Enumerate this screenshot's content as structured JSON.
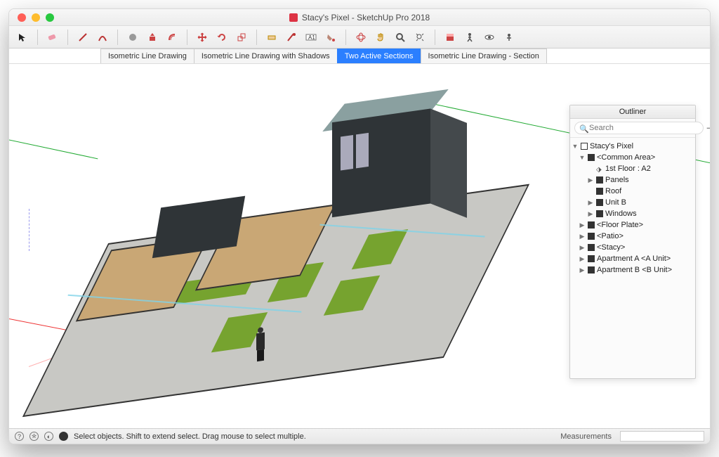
{
  "window": {
    "title": "Stacy's Pixel - SketchUp Pro 2018"
  },
  "toolbar_icons": [
    "select",
    "eraser",
    "line",
    "arc",
    "shape",
    "pushpull",
    "offset",
    "move",
    "rotate",
    "scale",
    "tape",
    "protractor",
    "text",
    "dimension",
    "paint",
    "orbit",
    "pan",
    "zoom",
    "section",
    "walk",
    "position",
    "lookAround"
  ],
  "scenes": [
    {
      "label": "Isometric Line Drawing",
      "active": false
    },
    {
      "label": "Isometric Line Drawing with Shadows",
      "active": false
    },
    {
      "label": "Two Active Sections",
      "active": true
    },
    {
      "label": "Isometric Line Drawing - Section",
      "active": false
    }
  ],
  "outliner": {
    "title": "Outliner",
    "search_placeholder": "Search",
    "items": [
      {
        "depth": 0,
        "tw": "▼",
        "icon": "mdl",
        "label": "Stacy's Pixel"
      },
      {
        "depth": 1,
        "tw": "▼",
        "icon": "grp",
        "label": "<Common Area>"
      },
      {
        "depth": 2,
        "tw": "",
        "icon": "sec",
        "label": "1st Floor : A2"
      },
      {
        "depth": 2,
        "tw": "▶",
        "icon": "grp",
        "label": "Panels"
      },
      {
        "depth": 2,
        "tw": "",
        "icon": "grp",
        "label": "Roof"
      },
      {
        "depth": 2,
        "tw": "▶",
        "icon": "grp",
        "label": "Unit B"
      },
      {
        "depth": 2,
        "tw": "▶",
        "icon": "grp",
        "label": "Windows"
      },
      {
        "depth": 1,
        "tw": "▶",
        "icon": "grp",
        "label": "<Floor Plate>"
      },
      {
        "depth": 1,
        "tw": "▶",
        "icon": "grp",
        "label": "<Patio>"
      },
      {
        "depth": 1,
        "tw": "▶",
        "icon": "grp",
        "label": "<Stacy>"
      },
      {
        "depth": 1,
        "tw": "▶",
        "icon": "grp",
        "label": "Apartment A <A Unit>"
      },
      {
        "depth": 1,
        "tw": "▶",
        "icon": "grp",
        "label": "Apartment B <B Unit>"
      }
    ]
  },
  "status": {
    "hint": "Select objects. Shift to extend select. Drag mouse to select multiple.",
    "measurements_label": "Measurements",
    "measurements_value": ""
  },
  "colors": {
    "accent": "#2b7fff"
  }
}
